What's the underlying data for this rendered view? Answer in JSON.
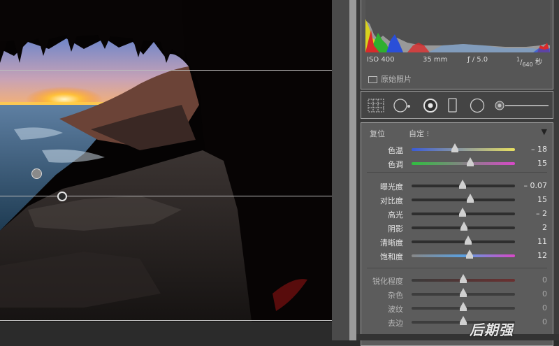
{
  "photo": {
    "pins": [
      "point-a",
      "point-b"
    ]
  },
  "histogram": {
    "iso": "ISO 400",
    "focal": "35 mm",
    "aperture": "ƒ / 5.0",
    "shutter_num": "1",
    "shutter_den": "640",
    "shutter_unit": "秒",
    "original_label": "原始照片"
  },
  "toolbar": {
    "tools": [
      "grid-tool-icon",
      "crop-tool-icon",
      "spot-removal-icon",
      "gradient-filter-icon",
      "radial-filter-icon",
      "brush-slider"
    ]
  },
  "basic": {
    "reset_label": "复位",
    "preset_label": "自定 ⁝",
    "collapse_glyph": "▼",
    "groups": [
      {
        "rows": [
          {
            "label": "色温",
            "value": "– 18",
            "pos": 0.42
          },
          {
            "label": "色调",
            "value": "15",
            "pos": 0.57
          }
        ]
      },
      {
        "rows": [
          {
            "label": "曝光度",
            "value": "– 0.07",
            "pos": 0.49
          },
          {
            "label": "对比度",
            "value": "15",
            "pos": 0.57
          },
          {
            "label": "高光",
            "value": "– 2",
            "pos": 0.49
          },
          {
            "label": "阴影",
            "value": "2",
            "pos": 0.51
          },
          {
            "label": "清晰度",
            "value": "11",
            "pos": 0.55
          },
          {
            "label": "饱和度",
            "value": "12",
            "pos": 0.56
          }
        ]
      },
      {
        "rows": [
          {
            "label": "锐化程度",
            "value": "0",
            "pos": 0.5
          },
          {
            "label": "杂色",
            "value": "0",
            "pos": 0.5
          },
          {
            "label": "波纹",
            "value": "0",
            "pos": 0.5
          },
          {
            "label": "去边",
            "value": "0",
            "pos": 0.5
          }
        ]
      }
    ]
  },
  "watermark": "后期强",
  "colors": {
    "panel": "#3b3b3b",
    "section": "#5c5c5c",
    "accent_sun": "#ffb22a"
  }
}
